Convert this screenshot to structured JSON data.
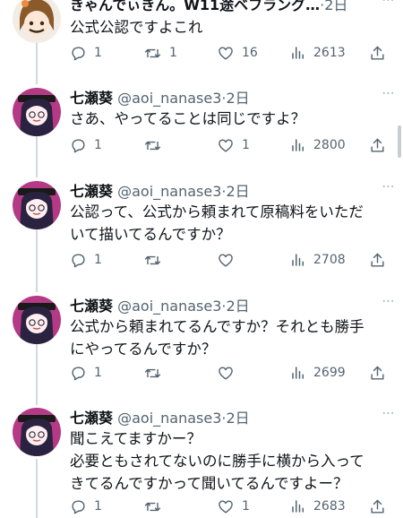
{
  "tweets": [
    {
      "name": "きゃんでぃきん。W11途ベフラング…",
      "handle": "",
      "time": "2日",
      "lines": [
        "公式公認ですよこれ"
      ],
      "reply": "1",
      "retweet": "1",
      "like": "16",
      "views": "2613"
    },
    {
      "name": "七瀬葵",
      "handle": "@aoi_nanase3",
      "time": "2日",
      "lines": [
        "さあ、やってることは同じですよ？"
      ],
      "reply": "1",
      "retweet": "",
      "like": "1",
      "views": "2800"
    },
    {
      "name": "七瀬葵",
      "handle": "@aoi_nanase3",
      "time": "2日",
      "lines": [
        "公認って、公式から頼まれて原稿料をいただ",
        "いて描いてるんですか？"
      ],
      "reply": "1",
      "retweet": "",
      "like": "",
      "views": "2708"
    },
    {
      "name": "七瀬葵",
      "handle": "@aoi_nanase3",
      "time": "2日",
      "lines": [
        "公式から頼まれてるんですか？それとも勝手",
        "にやってるんですか？"
      ],
      "reply": "1",
      "retweet": "",
      "like": "",
      "views": "2699"
    },
    {
      "name": "七瀬葵",
      "handle": "@aoi_nanase3",
      "time": "2日",
      "lines": [
        "聞こえてますかー？",
        "必要ともされてないのに勝手に横から入って",
        "きてるんですかって聞いてるんですよー？"
      ],
      "reply": "1",
      "retweet": "",
      "like": "1",
      "views": "2683"
    }
  ],
  "colors": {
    "text": "#0f1419",
    "muted": "#536471",
    "thread": "#cfd9de"
  }
}
